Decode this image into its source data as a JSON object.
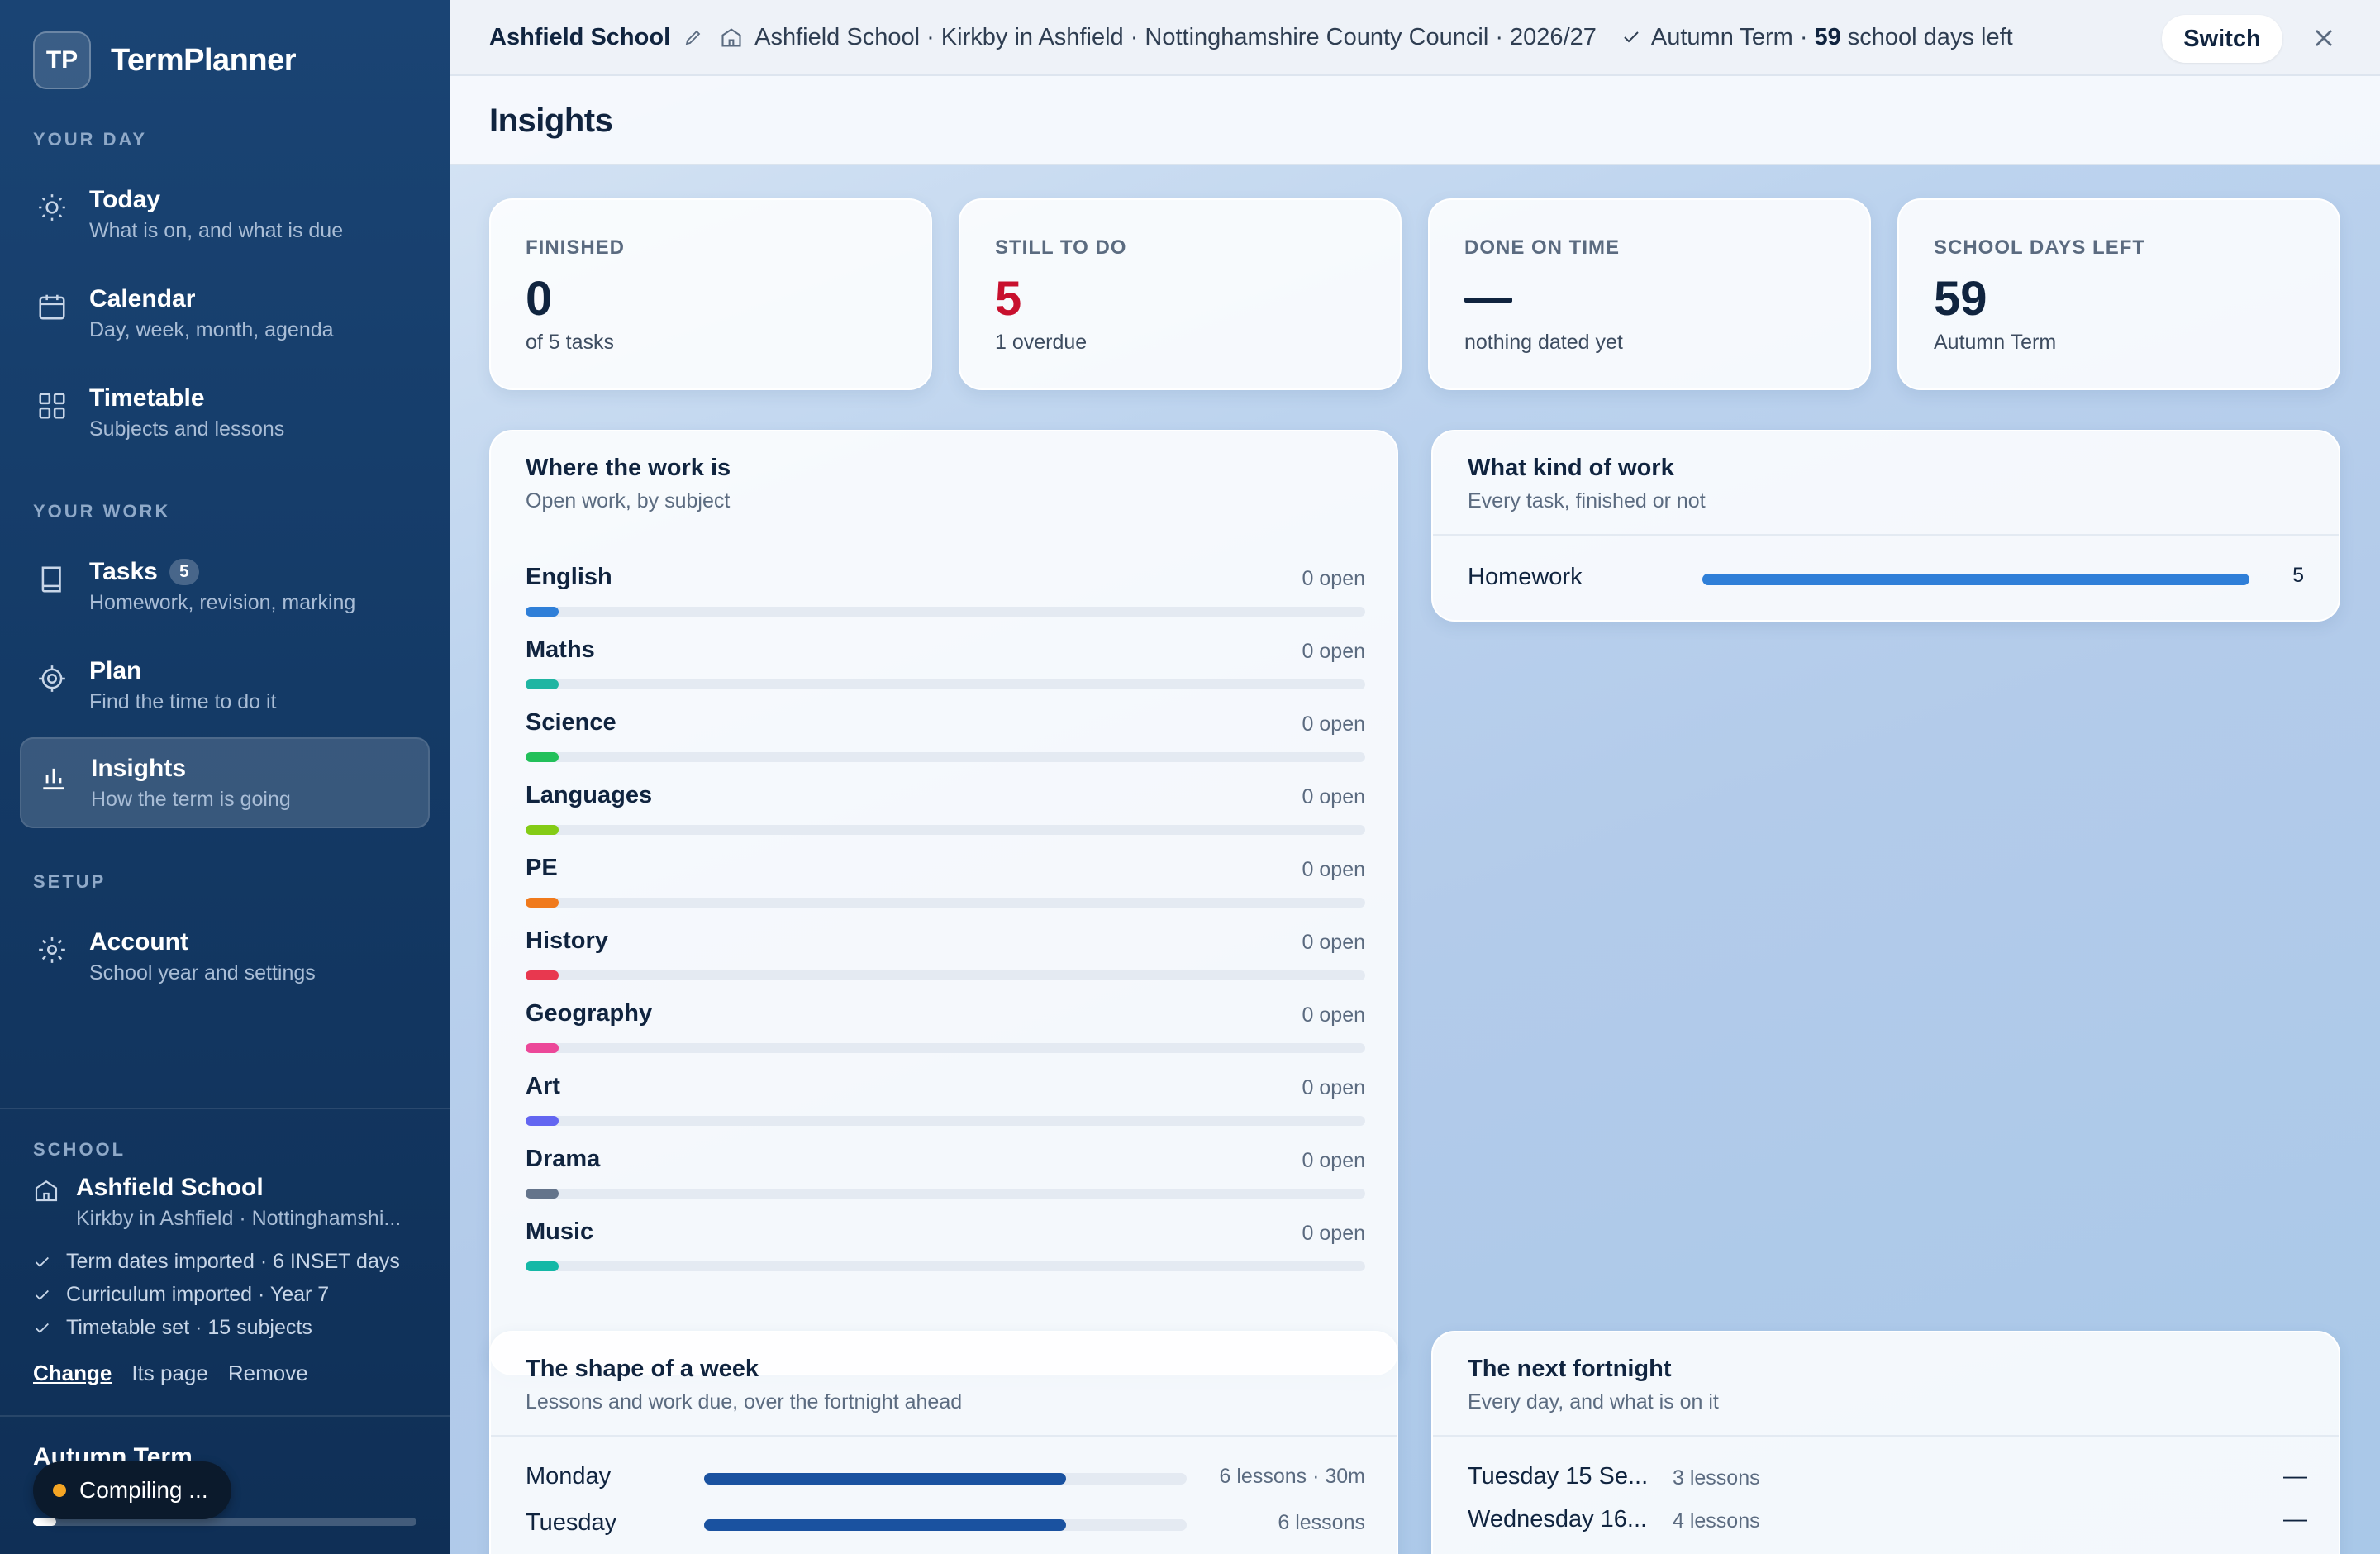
{
  "brand": {
    "logo": "TP",
    "name": "TermPlanner"
  },
  "sidebar": {
    "sections": [
      {
        "label": "YOUR DAY"
      },
      {
        "label": "YOUR WORK"
      },
      {
        "label": "SETUP"
      }
    ],
    "items": [
      {
        "title": "Today",
        "subtitle": "What is on, and what is due",
        "icon": "sun-icon"
      },
      {
        "title": "Calendar",
        "subtitle": "Day, week, month, agenda",
        "icon": "calendar-icon"
      },
      {
        "title": "Timetable",
        "subtitle": "Subjects and lessons",
        "icon": "grid-icon"
      },
      {
        "title": "Tasks",
        "subtitle": "Homework, revision, marking",
        "icon": "book-icon",
        "badge": "5"
      },
      {
        "title": "Plan",
        "subtitle": "Find the time to do it",
        "icon": "target-icon"
      },
      {
        "title": "Insights",
        "subtitle": "How the term is going",
        "icon": "bar-chart-icon",
        "active": true
      },
      {
        "title": "Account",
        "subtitle": "School year and settings",
        "icon": "gear-icon"
      }
    ],
    "school": {
      "label": "SCHOOL",
      "name": "Ashfield School",
      "location": "Kirkby in Ashfield · Nottinghamshi...",
      "checks": [
        "Term dates imported · 6 INSET days",
        "Curriculum imported · Year 7",
        "Timetable set · 15 subjects"
      ],
      "links": {
        "change": "Change",
        "page": "Its page",
        "remove": "Remove"
      }
    },
    "term": {
      "title": "Autumn Term",
      "progress": 0.06
    },
    "toast": {
      "label": "Compiling ..."
    }
  },
  "topbar": {
    "school": "Ashfield School",
    "context": "Ashfield School · Kirkby in Ashfield · Nottinghamshire County Council · 2026/27",
    "term": "Autumn Term ·",
    "days": "59",
    "days_suffix": "school days left",
    "switch_label": "Switch"
  },
  "page": {
    "title": "Insights"
  },
  "stats": [
    {
      "label": "FINISHED",
      "value": "0",
      "sub": "of 5 tasks"
    },
    {
      "label": "STILL TO DO",
      "value": "5",
      "sub": "1 overdue"
    },
    {
      "label": "DONE ON TIME",
      "value": "",
      "sub": "nothing dated yet"
    },
    {
      "label": "SCHOOL DAYS LEFT",
      "value": "59",
      "sub": "Autumn Term"
    }
  ],
  "subjects_card": {
    "title": "Where the work is",
    "subtitle": "Open work, by subject",
    "rows": [
      {
        "name": "English",
        "count": "0 open",
        "color": "#2f7fd8"
      },
      {
        "name": "Maths",
        "count": "0 open",
        "color": "#1fb5a2"
      },
      {
        "name": "Science",
        "count": "0 open",
        "color": "#22c05a"
      },
      {
        "name": "Languages",
        "count": "0 open",
        "color": "#84cc16"
      },
      {
        "name": "PE",
        "count": "0 open",
        "color": "#f07a1c"
      },
      {
        "name": "History",
        "count": "0 open",
        "color": "#e8384f"
      },
      {
        "name": "Geography",
        "count": "0 open",
        "color": "#ec4899"
      },
      {
        "name": "Art",
        "count": "0 open",
        "color": "#6366f1"
      },
      {
        "name": "Drama",
        "count": "0 open",
        "color": "#64748b"
      },
      {
        "name": "Music",
        "count": "0 open",
        "color": "#14b8a6"
      }
    ]
  },
  "kind_card": {
    "title": "What kind of work",
    "subtitle": "Every task, finished or not",
    "rows": [
      {
        "label": "Homework",
        "count": "5",
        "fraction": 1.0
      }
    ]
  },
  "week_card": {
    "title": "The shape of a week",
    "subtitle": "Lessons and work due, over the fortnight ahead",
    "rows": [
      {
        "day": "Monday",
        "info": "6 lessons · 30m",
        "fraction": 0.75
      },
      {
        "day": "Tuesday",
        "info": "6 lessons",
        "fraction": 0.75
      }
    ]
  },
  "fortnight_card": {
    "title": "The next fortnight",
    "subtitle": "Every day, and what is on it",
    "rows": [
      {
        "date": "Tuesday 15 Se...",
        "lessons": "3 lessons",
        "due": "—"
      },
      {
        "date": "Wednesday 16...",
        "lessons": "4 lessons",
        "due": "—"
      }
    ]
  }
}
